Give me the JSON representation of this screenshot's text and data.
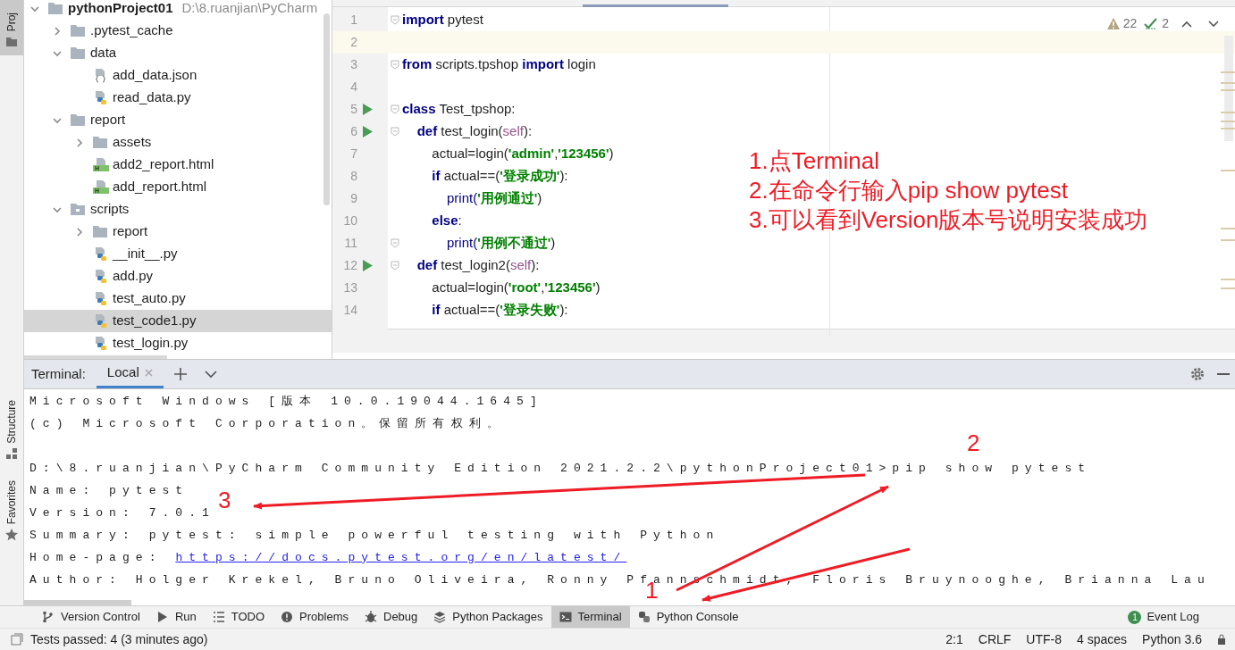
{
  "left_strip": {
    "tabs": [
      {
        "label": "Proj",
        "selected": true
      },
      {
        "label": "Structure",
        "selected": false
      },
      {
        "label": "Favorites",
        "selected": false
      }
    ]
  },
  "project_tree": {
    "root": {
      "label": "pythonProject01",
      "path": "D:\\8.ruanjian\\PyCharm",
      "kind": "folder",
      "expanded": true,
      "selected": false,
      "children": [
        {
          "label": ".pytest_cache",
          "kind": "folder",
          "expanded": false,
          "selected": false
        },
        {
          "label": "data",
          "kind": "folder",
          "expanded": true,
          "selected": false,
          "children": [
            {
              "label": "add_data.json",
              "kind": "json",
              "selected": false
            },
            {
              "label": "read_data.py",
              "kind": "python",
              "selected": false
            }
          ]
        },
        {
          "label": "report",
          "kind": "folder",
          "expanded": true,
          "selected": false,
          "children": [
            {
              "label": "assets",
              "kind": "folder",
              "expanded": false,
              "selected": false
            },
            {
              "label": "add2_report.html",
              "kind": "html",
              "selected": false
            },
            {
              "label": "add_report.html",
              "kind": "html",
              "selected": false
            }
          ]
        },
        {
          "label": "scripts",
          "kind": "source",
          "expanded": true,
          "selected": false,
          "children": [
            {
              "label": "report",
              "kind": "folder",
              "expanded": false,
              "selected": false
            },
            {
              "label": "__init__.py",
              "kind": "python",
              "selected": false
            },
            {
              "label": "add.py",
              "kind": "python",
              "selected": false
            },
            {
              "label": "test_auto.py",
              "kind": "python",
              "selected": false
            },
            {
              "label": "test_code1.py",
              "kind": "python",
              "selected": true
            },
            {
              "label": "test_login.py",
              "kind": "python",
              "selected": false
            }
          ]
        }
      ]
    }
  },
  "editor": {
    "inspections": {
      "warnings": "22",
      "passed": "2"
    },
    "lines": [
      {
        "number": "1",
        "run": false,
        "fold": true,
        "current": false,
        "tokens": [
          {
            "text": "import",
            "kind": "keyword"
          },
          {
            "text": " pytest",
            "kind": "plain"
          }
        ]
      },
      {
        "number": "2",
        "run": false,
        "fold": false,
        "current": true
      },
      {
        "number": "3",
        "run": false,
        "fold": true,
        "current": false,
        "tokens": [
          {
            "text": "from",
            "kind": "keyword"
          },
          {
            "text": " scripts.tpshop ",
            "kind": "plain"
          },
          {
            "text": "import",
            "kind": "keyword"
          },
          {
            "text": " login",
            "kind": "plain"
          }
        ]
      },
      {
        "number": "4",
        "run": false,
        "fold": false,
        "current": false
      },
      {
        "number": "5",
        "run": true,
        "fold": true,
        "current": false,
        "tokens": [
          {
            "text": "class",
            "kind": "keyword"
          },
          {
            "text": " Test_tpshop:",
            "kind": "plain"
          }
        ]
      },
      {
        "number": "6",
        "run": true,
        "fold": true,
        "current": false,
        "tokens": [
          {
            "text": "    def",
            "kind": "keyword"
          },
          {
            "text": " test_login(",
            "kind": "plain"
          },
          {
            "text": "self",
            "kind": "self"
          },
          {
            "text": "):",
            "kind": "plain"
          }
        ]
      },
      {
        "number": "7",
        "run": false,
        "fold": false,
        "current": false,
        "tokens": [
          {
            "text": "        actual=login(",
            "kind": "plain"
          },
          {
            "text": "'admin'",
            "kind": "string"
          },
          {
            "text": ",",
            "kind": "plain"
          },
          {
            "text": "'123456'",
            "kind": "string"
          },
          {
            "text": ")",
            "kind": "plain"
          }
        ]
      },
      {
        "number": "8",
        "run": false,
        "fold": false,
        "current": false,
        "tokens": [
          {
            "text": "        if",
            "kind": "keyword"
          },
          {
            "text": " actual==(",
            "kind": "plain"
          },
          {
            "text": "'登录成功'",
            "kind": "string"
          },
          {
            "text": "):",
            "kind": "plain"
          }
        ]
      },
      {
        "number": "9",
        "run": false,
        "fold": false,
        "current": false,
        "tokens": [
          {
            "text": "            print(",
            "kind": "builtin"
          },
          {
            "text": "'用例通过'",
            "kind": "string"
          },
          {
            "text": ")",
            "kind": "plain"
          }
        ]
      },
      {
        "number": "10",
        "run": false,
        "fold": false,
        "current": false,
        "tokens": [
          {
            "text": "        else",
            "kind": "keyword"
          },
          {
            "text": ":",
            "kind": "plain"
          }
        ]
      },
      {
        "number": "11",
        "run": false,
        "fold": true,
        "current": false,
        "tokens": [
          {
            "text": "            print(",
            "kind": "builtin"
          },
          {
            "text": "'用例不通过'",
            "kind": "string"
          },
          {
            "text": ")",
            "kind": "plain"
          }
        ]
      },
      {
        "number": "12",
        "run": true,
        "fold": true,
        "current": false,
        "tokens": [
          {
            "text": "    def",
            "kind": "keyword"
          },
          {
            "text": " test_login2(",
            "kind": "plain"
          },
          {
            "text": "self",
            "kind": "self"
          },
          {
            "text": "):",
            "kind": "plain"
          }
        ]
      },
      {
        "number": "13",
        "run": false,
        "fold": false,
        "current": false,
        "tokens": [
          {
            "text": "        actual=login(",
            "kind": "plain"
          },
          {
            "text": "'root'",
            "kind": "string"
          },
          {
            "text": ",",
            "kind": "plain"
          },
          {
            "text": "'123456'",
            "kind": "string"
          },
          {
            "text": ")",
            "kind": "plain"
          }
        ]
      },
      {
        "number": "14",
        "run": false,
        "fold": false,
        "current": false,
        "tokens": [
          {
            "text": "        if",
            "kind": "keyword"
          },
          {
            "text": " actual==(",
            "kind": "plain"
          },
          {
            "text": "'登录失败'",
            "kind": "string"
          },
          {
            "text": "):",
            "kind": "plain"
          }
        ]
      }
    ]
  },
  "terminal": {
    "title": "Terminal:",
    "tabs": [
      {
        "label": "Local",
        "selected": true
      }
    ],
    "lines": [
      {
        "kind": "text",
        "text": "Microsoft Windows [版本 10.0.19044.1645]"
      },
      {
        "kind": "text",
        "text": "(c) Microsoft Corporation。保留所有权利。"
      },
      {
        "kind": "blank"
      },
      {
        "kind": "text",
        "text": "D:\\8.ruanjian\\PyCharm Community Edition 2021.2.2\\pythonProject01>pip show pytest"
      },
      {
        "kind": "text",
        "text": "Name: pytest"
      },
      {
        "kind": "text",
        "text": "Version: 7.0.1"
      },
      {
        "kind": "text",
        "text": "Summary: pytest: simple powerful testing with Python"
      },
      {
        "kind": "link",
        "text": "Home-page: ",
        "link": "https://docs.pytest.org/en/latest/"
      },
      {
        "kind": "text",
        "text": "Author: Holger Krekel, Bruno Oliveira, Ronny Pfannschmidt, Floris Bruynooghe, Brianna Lau"
      }
    ]
  },
  "tool_windows": [
    {
      "label": "Version Control",
      "kind": "vcs",
      "selected": false
    },
    {
      "label": "Run",
      "kind": "run",
      "selected": false
    },
    {
      "label": "TODO",
      "kind": "todo",
      "selected": false
    },
    {
      "label": "Problems",
      "kind": "problems",
      "selected": false
    },
    {
      "label": "Debug",
      "kind": "debug",
      "selected": false
    },
    {
      "label": "Python Packages",
      "kind": "packages",
      "selected": false
    },
    {
      "label": "Terminal",
      "kind": "terminal",
      "selected": true
    },
    {
      "label": "Python Console",
      "kind": "console",
      "selected": false
    }
  ],
  "event_log": {
    "label": "Event Log",
    "count": "1"
  },
  "status_bar": {
    "message": "Tests passed: 4 (3 minutes ago)",
    "items": [
      "2:1",
      "CRLF",
      "UTF-8",
      "4 spaces",
      "Python 3.6"
    ]
  },
  "annotations": {
    "notes": [
      "1.点Terminal",
      "2.在命令行输入pip show pytest",
      "3.可以看到Version版本号说明安装成功"
    ],
    "markers": [
      "1",
      "2",
      "3"
    ]
  }
}
